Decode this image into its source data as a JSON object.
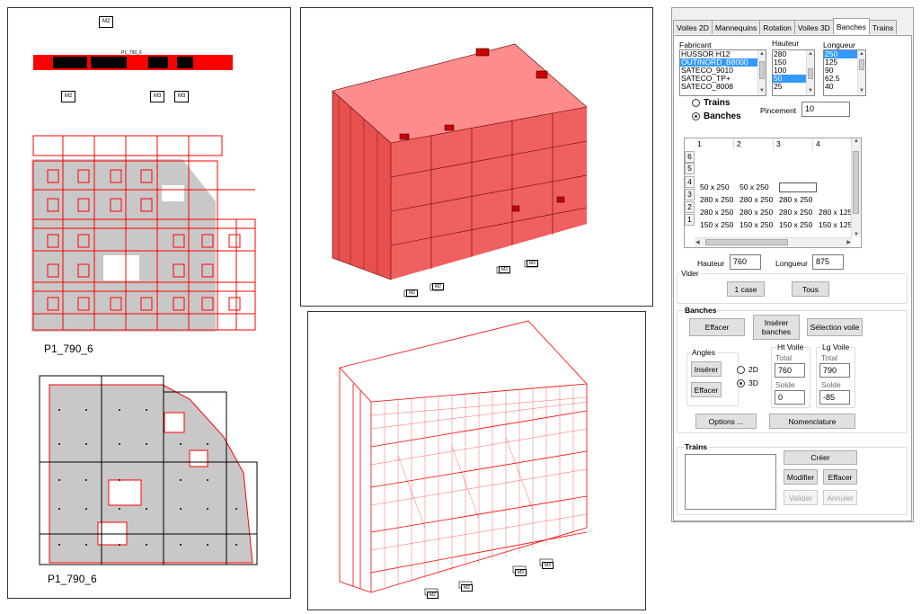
{
  "plan_top": {
    "tags": [
      "M2",
      "M2",
      "M3",
      "M3"
    ],
    "beam_label": "P1_790_6",
    "caption": "P1_790_6"
  },
  "plan_bottom": {
    "caption": "P1_790_6"
  },
  "view_3d_top": {
    "tags": [
      "M2",
      "M2",
      "M3",
      "M3"
    ]
  },
  "view_3d_bottom": {
    "tags": [
      "M2",
      "M2",
      "M3",
      "M3"
    ]
  },
  "colors": {
    "formwork_red": "#ff0000",
    "panel_gray": "#c8c8c8",
    "selection_blue": "#3399ff"
  },
  "dialog": {
    "tabs": [
      "Voiles 2D",
      "Mannequins",
      "Rotation",
      "Voiles 3D",
      "Banches",
      "Trains"
    ],
    "active_tab": "Banches",
    "fabricant_label": "Fabricant",
    "fabricants": [
      "HUSSOR H12",
      "OUTINORD_B8000",
      "SATECO_9010",
      "SATECO_TP+",
      "SATECO_8008"
    ],
    "fabricant_selected": "OUTINORD_B8000",
    "hauteur_label": "Hauteur",
    "hauteurs": [
      "280",
      "150",
      "100",
      "50",
      "25"
    ],
    "hauteur_selected": "50",
    "longueur_label": "Longueur",
    "longueurs": [
      "250",
      "125",
      "90",
      "62.5",
      "40"
    ],
    "longueur_selected": "250",
    "radio_trains": "Trains",
    "radio_banches": "Banches",
    "pincement_label": "Pincement",
    "pincement_value": "10",
    "grid": {
      "col_headers": [
        "1",
        "2",
        "3",
        "4"
      ],
      "row_headers": [
        "6",
        "5",
        "4",
        "3",
        "2",
        "1"
      ],
      "rows": [
        [
          "50 x 250",
          "50 x 250",
          "",
          ""
        ],
        [
          "280 x 250",
          "280 x 250",
          "280 x 250",
          ""
        ],
        [
          "280 x 250",
          "280 x 250",
          "280 x 250",
          "280 x 125"
        ],
        [
          "150 x 250",
          "150 x 250",
          "150 x 250",
          "150 x 125"
        ]
      ]
    },
    "hauteur_total_label": "Hauteur",
    "hauteur_total_value": "760",
    "longueur_total_label": "Longueur",
    "longueur_total_value": "875",
    "vider_label": "Vider",
    "btn_1case": "1 case",
    "btn_tous": "Tous",
    "banches_label": "Banches",
    "btn_effacer": "Effacer",
    "btn_inserer_banches": "Insérer banches",
    "btn_selection_voile": "Sélection voile",
    "angles_label": "Angles",
    "btn_inserer": "Insérer",
    "btn_effacer_angles": "Effacer",
    "radio_2d": "2D",
    "radio_3d": "3D",
    "ht_voile_label": "Ht Voile",
    "lg_voile_label": "Lg Voile",
    "total_label": "Total",
    "solde_label": "Solde",
    "ht_total_value": "760",
    "ht_solde_value": "0",
    "lg_total_value": "790",
    "lg_solde_value": "-85",
    "btn_options": "Options ...",
    "btn_nomenclature": "Nomenclature",
    "trains_label": "Trains",
    "btn_creer": "Créer",
    "btn_modifier": "Modifier",
    "btn_effacer_trains": "Effacer",
    "btn_valider": "Valider",
    "btn_annuler": "Annuler"
  }
}
